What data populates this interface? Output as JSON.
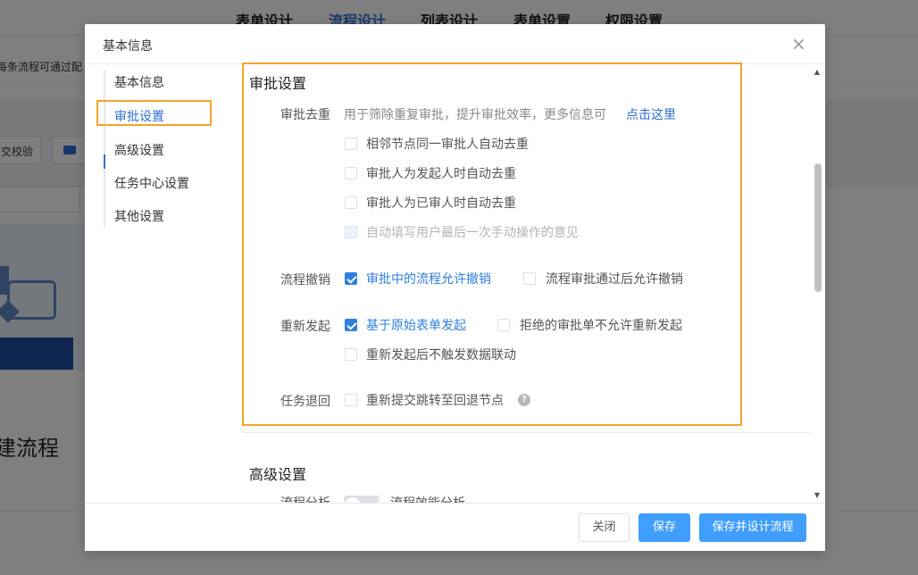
{
  "background": {
    "tabs": [
      "表单设计",
      "流程设计",
      "列表设计",
      "表单设置",
      "权限设置"
    ],
    "active_tab": 1,
    "notice_text": "每条流程可通过配",
    "verify_btn": "交校验",
    "big_text": "建流程"
  },
  "modal": {
    "title": "基本信息",
    "sidenav": [
      "基本信息",
      "审批设置",
      "高级设置",
      "任务中心设置",
      "其他设置"
    ],
    "active_nav": 1,
    "approval": {
      "section_title": "审批设置",
      "dedup": {
        "label": "审批去重",
        "desc": "用于筛除重复审批，提升审批效率，更多信息可",
        "link": "点击这里",
        "options": [
          "相邻节点同一审批人自动去重",
          "审批人为发起人时自动去重",
          "审批人为已审人时自动去重",
          "自动填写用户最后一次手动操作的意见"
        ],
        "disabled_option": 3
      },
      "withdraw": {
        "label": "流程撤销",
        "options": [
          "审批中的流程允许撤销",
          "流程审批通过后允许撤销"
        ],
        "checked": [
          true,
          false
        ]
      },
      "resubmit": {
        "label": "重新发起",
        "options": [
          "基于原始表单发起",
          "拒绝的审批单不允许重新发起",
          "重新发起后不触发数据联动"
        ],
        "checked": [
          true,
          false,
          false
        ]
      },
      "task_return": {
        "label": "任务退回",
        "option": "重新提交跳转至回退节点",
        "help": "?"
      }
    },
    "advanced": {
      "section_title": "高级设置",
      "row_label": "流程分析",
      "toggle_label": "流程效能分析"
    },
    "footer": {
      "close": "关闭",
      "save": "保存",
      "save_design": "保存并设计流程"
    }
  },
  "colors": {
    "accent": "#2f6fd1",
    "highlight": "#f4a52b",
    "primary_button": "#409eff"
  }
}
